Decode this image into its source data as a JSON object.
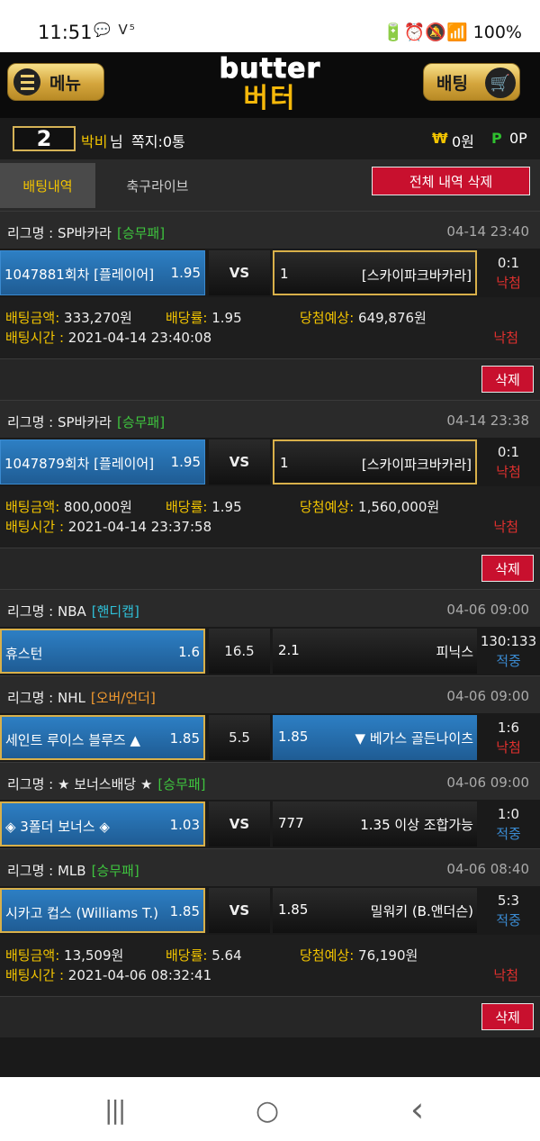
{
  "status": {
    "time": "11:51",
    "left_icons": "💬 V⁵",
    "right_icons": "🔋⏰🔕📶",
    "battery": "100%"
  },
  "header": {
    "menu_label": "메뉴",
    "bet_label": "배팅",
    "logo_en": "butter",
    "logo_ko": "버터"
  },
  "user": {
    "level": "2",
    "name": "박비",
    "honorific": "님",
    "note": "쪽지:0통",
    "won_symbol": "₩",
    "money": "0원",
    "point_symbol": "P",
    "points": "0P"
  },
  "tabs": {
    "active": "배팅내역",
    "other": "축구라이브",
    "delete_all": "전체 내역 삭제"
  },
  "labels": {
    "bet_amount": "배팅금액: ",
    "odds": "배당률: ",
    "expected": "당첨예상: ",
    "bet_time": "배팅시간 : ",
    "delete": "삭제"
  },
  "blocks": [
    {
      "league": "리그명 : SP바카라",
      "tag": "[승무패]",
      "tag_color": "#3ec43e",
      "date": "04-14 23:40",
      "rows": [
        {
          "home": "1047881회차 [플레이어]",
          "home_odds": "1.95",
          "mid": "VS",
          "away_odds": "1",
          "away": "[스카이파크바카라]",
          "score": "0:1",
          "status": "낙첨"
        }
      ],
      "info": {
        "amount": "333,270원",
        "odds": "1.95",
        "expected": "649,876원",
        "time": "2021-04-14 23:40:08",
        "status": "낙첨"
      }
    },
    {
      "league": "리그명 : SP바카라",
      "tag": "[승무패]",
      "tag_color": "#3ec43e",
      "date": "04-14 23:38",
      "rows": [
        {
          "home": "1047879회차 [플레이어]",
          "home_odds": "1.95",
          "mid": "VS",
          "away_odds": "1",
          "away": "[스카이파크바카라]",
          "score": "0:1",
          "status": "낙첨"
        }
      ],
      "info": {
        "amount": "800,000원",
        "odds": "1.95",
        "expected": "1,560,000원",
        "time": "2021-04-14 23:37:58",
        "status": "낙첨"
      }
    },
    {
      "league": "리그명 : NBA",
      "tag": "[핸디캡]",
      "tag_color": "#2fc0d8",
      "date": "04-06 09:00",
      "rows": [
        {
          "home": "휴스턴",
          "home_odds": "1.6",
          "mid": "16.5",
          "away_odds": "2.1",
          "away": "피닉스",
          "score": "130:133",
          "status": "적중"
        }
      ]
    },
    {
      "league": "리그명 : NHL",
      "tag": "[오버/언더]",
      "tag_color": "#f29a2e",
      "date": "04-06 09:00",
      "rows": [
        {
          "home": "세인트 루이스 블루즈 ▲",
          "home_odds": "1.85",
          "mid": "5.5",
          "away_odds": "1.85",
          "away": "▼ 베가스 골든나이츠",
          "score": "1:6",
          "status": "낙첨"
        }
      ]
    },
    {
      "league": "리그명 : ★ 보너스배당 ★",
      "tag": "[승무패]",
      "tag_color": "#3ec43e",
      "date": "04-06 09:00",
      "rows": [
        {
          "home": "◈ 3폴더 보너스 ◈",
          "home_odds": "1.03",
          "mid": "VS",
          "away_odds": "777",
          "away": "1.35 이상 조합가능",
          "score": "1:0",
          "status": "적중"
        }
      ]
    },
    {
      "league": "리그명 : MLB",
      "tag": "[승무패]",
      "tag_color": "#3ec43e",
      "date": "04-06 08:40",
      "rows": [
        {
          "home": "시카고 컵스 (Williams T.)",
          "home_odds": "1.85",
          "mid": "VS",
          "away_odds": "1.85",
          "away": "밀워키 (B.앤더슨)",
          "score": "5:3",
          "status": "적중"
        }
      ],
      "info": {
        "amount": "13,509원",
        "odds": "5.64",
        "expected": "76,190원",
        "time": "2021-04-06 08:32:41",
        "status": "낙첨"
      }
    }
  ],
  "navbar": {
    "recent": "|||",
    "home": "○",
    "back": "‹"
  }
}
